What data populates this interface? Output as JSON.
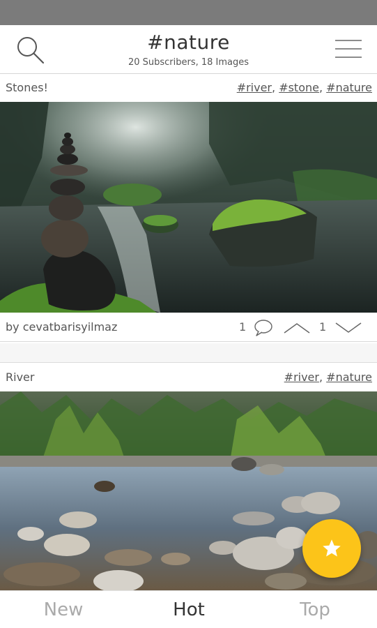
{
  "header": {
    "title": "#nature",
    "subtitle": "20 Subscribers, 18 Images"
  },
  "posts": [
    {
      "title": "Stones!",
      "tags": [
        "#river",
        "#stone",
        "#nature"
      ],
      "author": "by cevatbarisyilmaz",
      "comments": "1",
      "votes": "1"
    },
    {
      "title": "River",
      "tags": [
        "#river",
        "#nature"
      ]
    }
  ],
  "nav": {
    "new_label": "New",
    "hot_label": "Hot",
    "top_label": "Top"
  },
  "icons": {
    "search": "search-icon",
    "menu": "hamburger-menu-icon",
    "comment": "comment-icon",
    "upvote": "upvote-chevron-icon",
    "downvote": "downvote-chevron-icon",
    "fab": "star-icon"
  },
  "colors": {
    "status_bar": "#7b7b7b",
    "fab": "#fcc419",
    "text": "#555555",
    "nav_active": "#333333",
    "nav_inactive": "#aaaaaa"
  }
}
